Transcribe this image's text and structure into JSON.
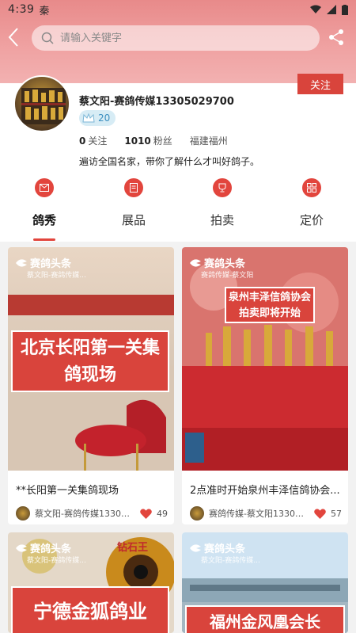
{
  "status": {
    "time": "4:39",
    "app_indicator": "秦"
  },
  "search": {
    "placeholder": "请输入关键字"
  },
  "profile": {
    "name": "蔡文阳-赛鸽传媒13305029700",
    "level": "20",
    "follow_label": "关注",
    "following_count": "0",
    "following_label": "关注",
    "fans_count": "1010",
    "fans_label": "粉丝",
    "location": "福建福州",
    "bio": "遍访全国名家，带你了解什么才叫好鸽子。"
  },
  "tabs": [
    {
      "label": "鸽秀",
      "icon": "mail-icon",
      "active": true
    },
    {
      "label": "展品",
      "icon": "document-icon",
      "active": false
    },
    {
      "label": "拍卖",
      "icon": "trophy-icon",
      "active": false
    },
    {
      "label": "定价",
      "icon": "grid-icon",
      "active": false
    }
  ],
  "cards": [
    {
      "brand": "赛鸽头条",
      "brand_sub": "蔡文阳-赛鸽传媒...",
      "overlay_text": "北京长阳第一关集鸽现场",
      "title": "**长阳第一关集鸽现场",
      "author": "蔡文阳-赛鸽传媒13305...",
      "likes": "49"
    },
    {
      "brand": "赛鸽头条",
      "brand_sub": "赛鸽传媒-蔡文阳",
      "overlay_text": "泉州丰泽信鸽协会拍卖即将开始",
      "title": "2点准时开始泉州丰泽信鸽协会...",
      "author": "赛鸽传媒-蔡文阳13305...",
      "likes": "57"
    },
    {
      "brand": "赛鸽头条",
      "brand_sub": "蔡文阳-赛鸽传媒...",
      "overlay_text": "宁德金狐鸽业",
      "badge": "钻石王"
    },
    {
      "brand": "赛鸽头条",
      "brand_sub": "蔡文阳-赛鸽传媒...",
      "overlay_text": "福州金风凰会长"
    }
  ],
  "colors": {
    "accent": "#e2453d",
    "header": "#f0a3a3"
  }
}
